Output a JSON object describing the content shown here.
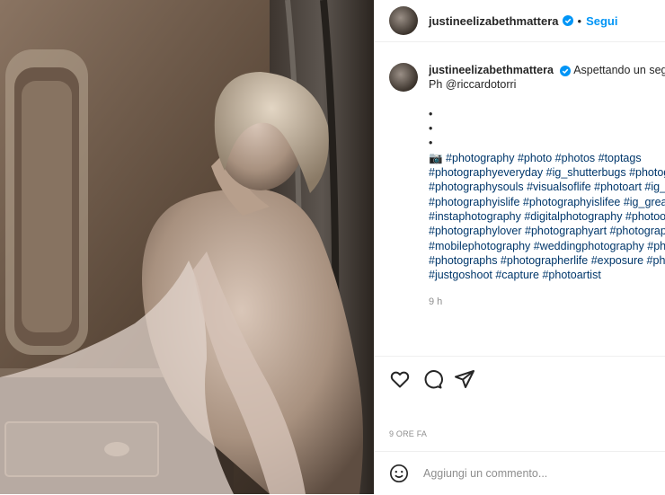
{
  "post": {
    "username": "justineelizabethmattera",
    "separator": "•",
    "follow_label": "Segui",
    "caption_lines": [
      "Aspettando un segno",
      "Ph @riccardotorri",
      "",
      "•",
      "•",
      "•",
      "📷 #photography #photo #photos #toptags",
      "#photographyeveryday #ig_shutterbugs #photographer",
      "#photographysouls #visualsoflife #photoart #ig_captures",
      "#photographyislife #photographyislifee #ig_great_shots",
      "#instaphotography #digitalphotography #photooftheday",
      "#photographylover #photographyart #photography",
      "#mobilephotography #weddingphotography #photographers",
      "#photographs #photographerlife #exposure #photographyy",
      "#justgoshoot #capture #photoartist"
    ],
    "caption_time": "9 h",
    "posted_ago": "9 ORE FA",
    "comment_placeholder": "Aggiungi un commento..."
  },
  "icons": {
    "verified": "verified-badge-icon",
    "like": "heart-icon",
    "comment": "comment-icon",
    "share": "paper-plane-icon",
    "emoji": "emoji-icon"
  },
  "colors": {
    "follow": "#0095f6",
    "verified": "#0095f6",
    "hashtag": "#00376b",
    "meta": "#8e8e8e"
  }
}
